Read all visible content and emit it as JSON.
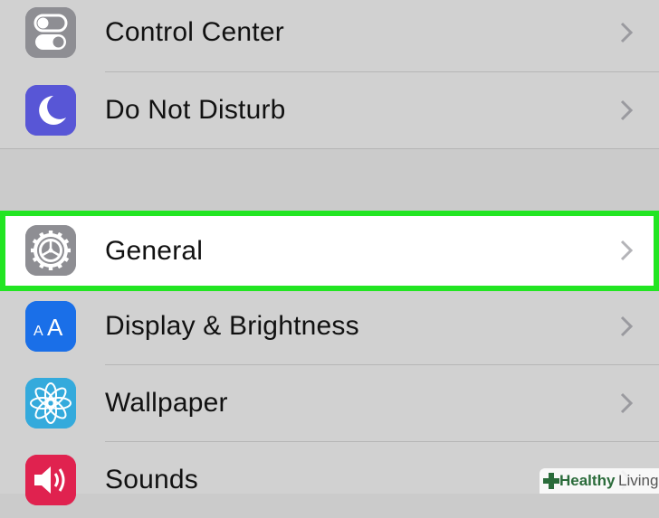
{
  "settings": {
    "group1": [
      {
        "label": "Control Center",
        "icon": "switches-icon",
        "icon_color": "#8e8e93"
      },
      {
        "label": "Do Not Disturb",
        "icon": "moon-icon",
        "icon_color": "#5856d6"
      }
    ],
    "highlighted": {
      "label": "General",
      "icon": "gear-icon",
      "icon_color": "#8e8e93"
    },
    "group2": [
      {
        "label": "Display & Brightness",
        "icon": "text-size-icon",
        "icon_color": "#1a6fe8"
      },
      {
        "label": "Wallpaper",
        "icon": "flower-icon",
        "icon_color": "#34aadc"
      },
      {
        "label": "Sounds",
        "icon": "speaker-icon",
        "icon_color": "#e0224f"
      }
    ]
  },
  "watermark": {
    "part1": "Healthy",
    "part2": "Living"
  },
  "colors": {
    "highlight_border": "#22e522",
    "background": "#cbcbcb",
    "row_bg": "#d1d1d1"
  }
}
